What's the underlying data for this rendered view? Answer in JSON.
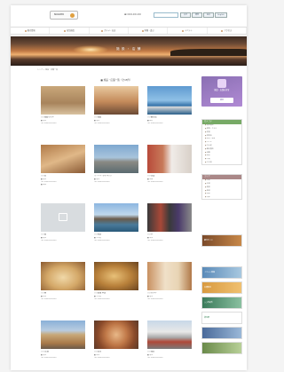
{
  "header": {
    "logo_text": "NAGOYA",
    "phone": "☎ 0000-000-000",
    "search_placeholder": "",
    "buttons": [
      "文字",
      "標準",
      "拡大",
      "English"
    ]
  },
  "nav": {
    "items": [
      "観光情報",
      "宿泊施設",
      "グルメ・お店",
      "体験・遊ぶ",
      "イベント",
      "アクセス"
    ]
  },
  "hero": {
    "title": "施 設 ・ 店 舗"
  },
  "breadcrumb": "トップ > 施設・店舗一覧",
  "section_title": "■ 施設・店舗一覧（全45件）",
  "cards": [
    {
      "name": "○○旅館ホテル",
      "lines": [
        "■ 宿泊",
        "TEL 0000-00-0000"
      ]
    },
    {
      "name": "○○旅館",
      "lines": [
        "■ 宿泊",
        "TEL 0000-00-0000"
      ]
    },
    {
      "name": "○○観光船",
      "lines": [
        "■ 観光",
        "TEL 0000-00-0000"
      ]
    },
    {
      "name": "○○荘",
      "lines": [
        "■ 宿泊",
        "TEL 0000-00-0000",
        "■ 温泉"
      ]
    },
    {
      "name": "リゾート ホテル○○",
      "lines": [
        "■ 宿泊",
        "TEL 0000-00-0000"
      ]
    },
    {
      "name": "○○漁業",
      "lines": [
        "■ 体験",
        "TEL 0000-00-0000"
      ]
    },
    {
      "name": "○○館",
      "lines": [
        "■ 宿泊",
        "TEL 0000-00-0000"
      ]
    },
    {
      "name": "○○商店",
      "lines": [
        "■ お土産",
        "TEL 0000-00-0000"
      ]
    },
    {
      "name": "○○亭",
      "lines": [
        "■ 飲食",
        "TEL 0000-00-0000"
      ]
    },
    {
      "name": "○○屋",
      "lines": [
        "■ 飲食",
        "TEL 0000-00-0000"
      ]
    },
    {
      "name": "○○製菓 本店",
      "lines": [
        "■ お土産",
        "TEL 0000-00-0000"
      ]
    },
    {
      "name": "○○ホテル",
      "lines": [
        "■ 宿泊",
        "TEL 0000-00-0000"
      ]
    },
    {
      "name": "○○ 民宿",
      "lines": [
        "■ 宿泊",
        "TEL 0000-00-0000"
      ]
    },
    {
      "name": "○○食堂",
      "lines": [
        "■ 飲食",
        "TEL 0000-00-0000"
      ]
    },
    {
      "name": "○○旅荘",
      "lines": [
        "■ 宿泊",
        "TEL 0000-00-0000"
      ]
    }
  ],
  "sidebar": {
    "promo_text": "施設・店舗を探す",
    "promo_button": "検索",
    "cat_head": "カテゴリ",
    "categories": [
      "宿泊施設",
      "旅館・ホテル",
      "民宿",
      "飲食店",
      "寿司・和食",
      "カフェ",
      "お土産",
      "観光施設",
      "体験",
      "温泉",
      "交通",
      "その他"
    ],
    "area_head": "エリア",
    "areas": [
      "北部",
      "中部",
      "南部",
      "東部",
      "西部",
      "沿岸"
    ],
    "banners": [
      "観光ガイド",
      "イベント情報",
      "交通案内",
      "○○市役所",
      "道の駅"
    ]
  }
}
